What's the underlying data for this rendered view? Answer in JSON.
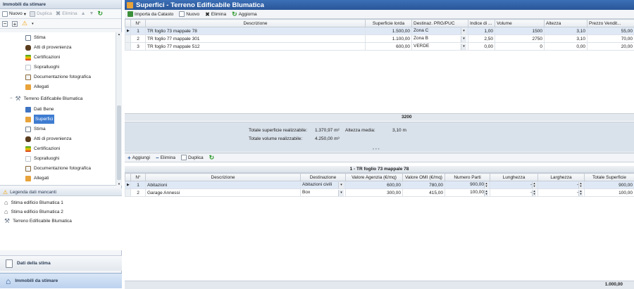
{
  "left_panel": {
    "title": "Immobili da stimare",
    "toolbar": {
      "new": "Nuovo",
      "duplicate": "Duplica",
      "delete": "Elimina"
    },
    "tree": [
      {
        "label": "Stima",
        "icon": "stima-icon",
        "level": 2
      },
      {
        "label": "Atti di provenienza",
        "icon": "atti-icon",
        "level": 2
      },
      {
        "label": "Certificazioni",
        "icon": "certificazioni-icon",
        "level": 2
      },
      {
        "label": "Sopralluoghi",
        "icon": "sopralluoghi-icon",
        "level": 2
      },
      {
        "label": "Documentazione fotografica",
        "icon": "foto-icon",
        "level": 2
      },
      {
        "label": "Allegati",
        "icon": "allegati-icon",
        "level": 2
      },
      {
        "label": "Terreno Edificabile Blumatica",
        "icon": "terreno-icon",
        "level": 1
      },
      {
        "label": "Dati Bene",
        "icon": "dati-bene-icon",
        "level": 2
      },
      {
        "label": "Superfici",
        "icon": "superfici-icon",
        "level": 2,
        "selected": true
      },
      {
        "label": "Stima",
        "icon": "stima-icon",
        "level": 2
      },
      {
        "label": "Atti di provenienza",
        "icon": "atti-icon",
        "level": 2
      },
      {
        "label": "Certificazioni",
        "icon": "certificazioni-icon",
        "level": 2
      },
      {
        "label": "Sopralluoghi",
        "icon": "sopralluoghi-icon",
        "level": 2
      },
      {
        "label": "Documentazione fotografica",
        "icon": "foto-icon",
        "level": 2
      },
      {
        "label": "Allegati",
        "icon": "allegati-icon",
        "level": 2
      }
    ],
    "legend": {
      "title": "Legenda dati mancanti",
      "items": [
        "Stima edificio Blumatica 1",
        "Stima edificio Blumatica 2",
        "Terreno Edificabile Blumatica"
      ]
    },
    "nav": {
      "dati_stima": "Dati della stima",
      "immobili": "Immobili da stimare"
    }
  },
  "main": {
    "title": "Superfici - Terreno Edificabile Blumatica",
    "toolbar": {
      "import": "Importa da Catasto",
      "new": "Nuovo",
      "delete": "Elimina",
      "refresh": "Aggiorna"
    },
    "table": {
      "headers": [
        "N°",
        "Descrizione",
        "Superficie lorda",
        "Destinaz. PRG/PUC",
        "Indice di ...",
        "Volume",
        "Altezza",
        "Prezzo Vendit..."
      ],
      "rows": [
        {
          "n": "1",
          "desc": "TR foglio 73 mappale 78",
          "sup": "1.500,00",
          "dest": "Zona C",
          "indice": "1,00",
          "vol": "1500",
          "alt": "3,10",
          "prezzo": "55,00"
        },
        {
          "n": "2",
          "desc": "TR foglio 77 mappale 301",
          "sup": "1.100,00",
          "dest": "Zona B",
          "indice": "2,50",
          "vol": "2750",
          "alt": "3,10",
          "prezzo": "70,00"
        },
        {
          "n": "3",
          "desc": "TR foglio 77 mappale 512",
          "sup": "600,00",
          "dest": "VERDE",
          "indice": "0,00",
          "vol": "0",
          "alt": "0,00",
          "prezzo": "20,00"
        }
      ],
      "volume_total": "3200"
    },
    "summary": {
      "sup_label": "Totale superficie realizzabile:",
      "sup_value": "1.370,97 m²",
      "alt_label": "Altezza media:",
      "alt_value": "3,10 m",
      "vol_label": "Totale volume realizzabile:",
      "vol_value": "4.250,00 m³"
    }
  },
  "detail": {
    "toolbar": {
      "add": "Aggiungi",
      "delete": "Elimina",
      "duplicate": "Duplica"
    },
    "group_title": "1 - TR foglio 73 mappale 78",
    "headers": [
      "N°",
      "Descrizione",
      "Destinazione",
      "Valore Agenzia (€/mq)",
      "Valore OMI (€/mq)",
      "Numero Parti",
      "Lunghezza",
      "Larghezza",
      "Totale Superficie"
    ],
    "rows": [
      {
        "n": "1",
        "desc": "Abitazioni",
        "dest": "Abitazioni civili",
        "agenzia": "600,00",
        "omi": "780,00",
        "parti": "900,00",
        "lung": "-",
        "larg": "-",
        "tot": "900,00"
      },
      {
        "n": "2",
        "desc": "Garage Annessi",
        "dest": "Box",
        "agenzia": "300,00",
        "omi": "415,00",
        "parti": "100,00",
        "lung": "-",
        "larg": "-",
        "tot": "100,00"
      }
    ],
    "total": "1.000,00"
  }
}
